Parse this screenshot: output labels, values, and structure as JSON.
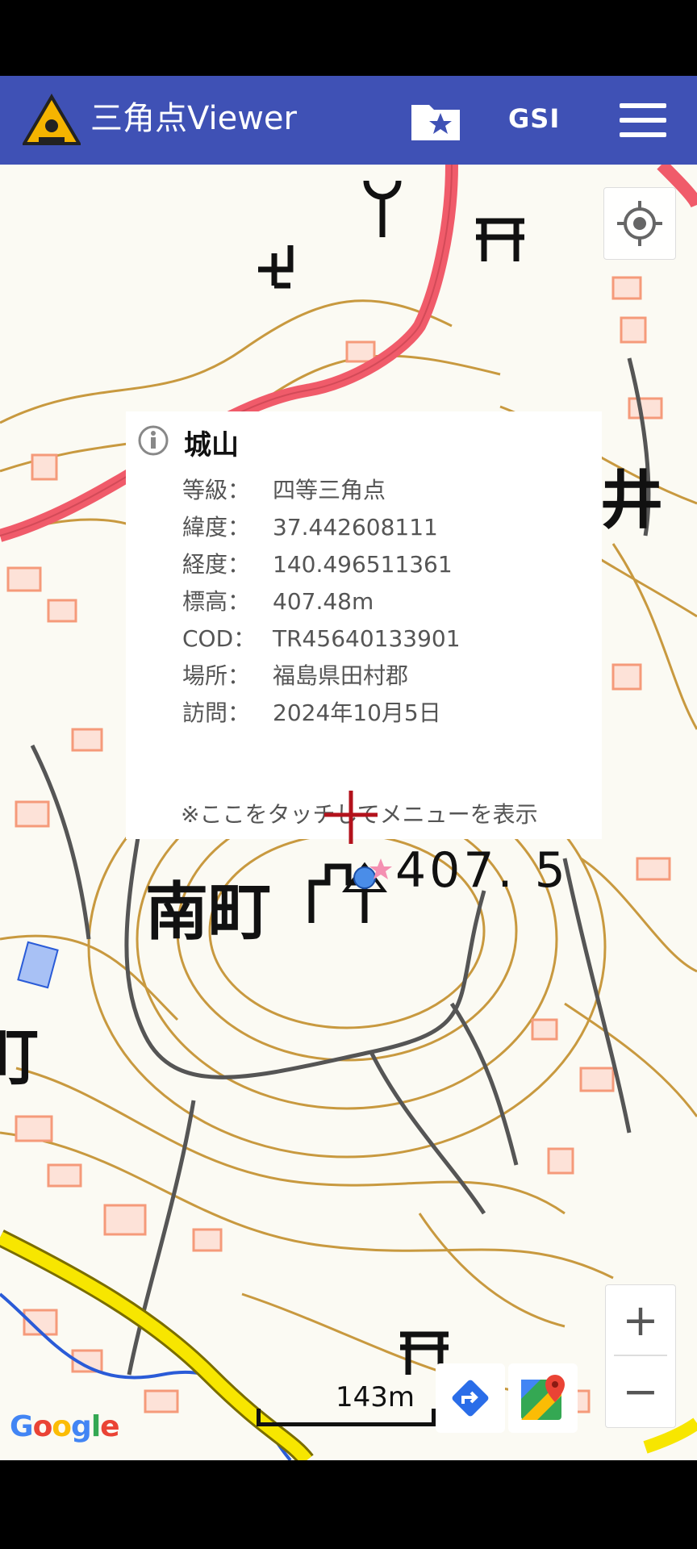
{
  "app": {
    "title": "三角点Viewer",
    "icons": {
      "logo": "orion-triangle-logo",
      "favorites": "folder-star-icon",
      "source": "GSI",
      "menu": "hamburger-menu-icon"
    },
    "brand_color": "#3f51b5"
  },
  "popup": {
    "name": "城山",
    "fields": [
      {
        "key": "等級",
        "sep": "：",
        "value": "四等三角点"
      },
      {
        "key": "緯度",
        "sep": "：",
        "value": "37.442608111"
      },
      {
        "key": "経度",
        "sep": "：",
        "value": "140.496511361"
      },
      {
        "key": "標高",
        "sep": "：",
        "value": "407.48m"
      },
      {
        "key": "COD",
        "sep": "：",
        "value": "TR45640133901"
      },
      {
        "key": "場所",
        "sep": "：",
        "value": "福島県田村郡"
      },
      {
        "key": "訪問",
        "sep": "：",
        "value": "2024年10月5日"
      }
    ],
    "hint": "※ここをタッチしてメニューを表示"
  },
  "map": {
    "labels": {
      "elevation": "407. 5",
      "town": "南町",
      "edge_right": "井",
      "edge_left": "町"
    },
    "scale_text": "143m",
    "attribution": "Google",
    "controls": {
      "zoom_in": "+",
      "zoom_out": "−"
    },
    "colors": {
      "contour": "#c8993f",
      "building": "#f59a7a",
      "main_road": "#f05b6a",
      "national_road": "#f7e600",
      "river": "#2a5bd7",
      "road": "#555555"
    }
  }
}
